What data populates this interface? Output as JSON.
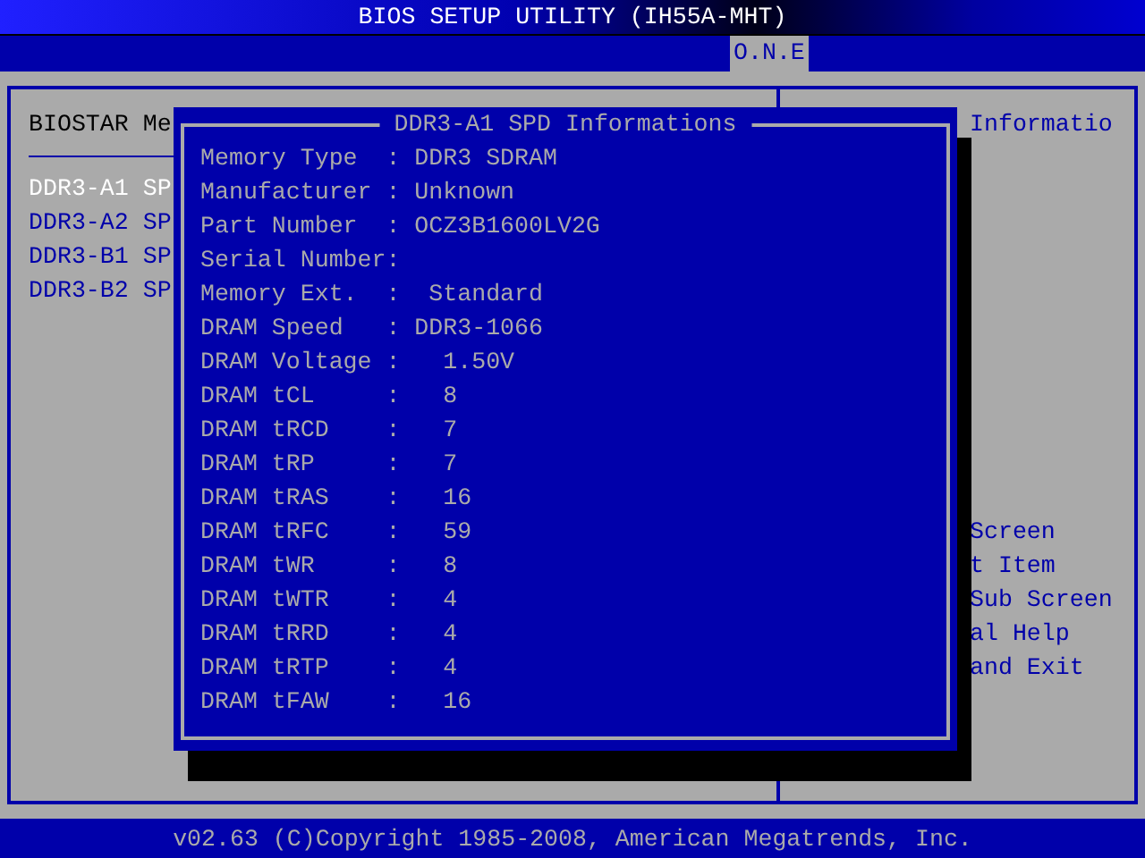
{
  "title": "BIOS SETUP UTILITY (IH55A-MHT)",
  "tabs": [
    {
      "label": "O.N.E",
      "selected": true
    }
  ],
  "left_panel": {
    "heading": "BIOSTAR Me",
    "items": [
      {
        "label": "DDR3-A1 SP",
        "selected": true
      },
      {
        "label": "DDR3-A2 SP",
        "selected": false
      },
      {
        "label": "DDR3-B1 SP",
        "selected": false
      },
      {
        "label": "DDR3-B2 SP",
        "selected": false
      }
    ]
  },
  "right_panel": {
    "heading": "Informatio",
    "help_lines": [
      "Screen",
      "t Item",
      "Sub Screen",
      "al Help",
      "and Exit"
    ]
  },
  "dialog": {
    "title": "DDR3-A1 SPD Informations",
    "rows": [
      {
        "label": "Memory Type",
        "sep": ":",
        "value": "DDR3 SDRAM",
        "kind": "text"
      },
      {
        "label": "Manufacturer",
        "sep": ":",
        "value": "Unknown",
        "kind": "text"
      },
      {
        "label": "Part Number",
        "sep": ":",
        "value": "OCZ3B1600LV2G",
        "kind": "text"
      },
      {
        "label": "Serial Number",
        "sep": ":"
      },
      {
        "label": "Memory Ext.",
        "sep": ":",
        "value": "Standard",
        "kind": "option"
      },
      {
        "label": "DRAM Speed",
        "sep": ":",
        "value": "DDR3-1066",
        "kind": "text"
      },
      {
        "label": "DRAM Voltage",
        "sep": ":",
        "value": "1.50V",
        "kind": "number"
      },
      {
        "label": "DRAM tCL",
        "sep": ":",
        "value": "8",
        "kind": "number"
      },
      {
        "label": "DRAM tRCD",
        "sep": ":",
        "value": "7",
        "kind": "number"
      },
      {
        "label": "DRAM tRP",
        "sep": ":",
        "value": "7",
        "kind": "number"
      },
      {
        "label": "DRAM tRAS",
        "sep": ":",
        "value": "16",
        "kind": "number"
      },
      {
        "label": "DRAM tRFC",
        "sep": ":",
        "value": "59",
        "kind": "number"
      },
      {
        "label": "DRAM tWR",
        "sep": ":",
        "value": "8",
        "kind": "number"
      },
      {
        "label": "DRAM tWTR",
        "sep": ":",
        "value": "4",
        "kind": "number"
      },
      {
        "label": "DRAM tRRD",
        "sep": ":",
        "value": "4",
        "kind": "number"
      },
      {
        "label": "DRAM tRTP",
        "sep": ":",
        "value": "4",
        "kind": "number"
      },
      {
        "label": "DRAM tFAW",
        "sep": ":",
        "value": "16",
        "kind": "number"
      }
    ]
  },
  "footer": "v02.63 (C)Copyright 1985-2008, American Megatrends, Inc."
}
